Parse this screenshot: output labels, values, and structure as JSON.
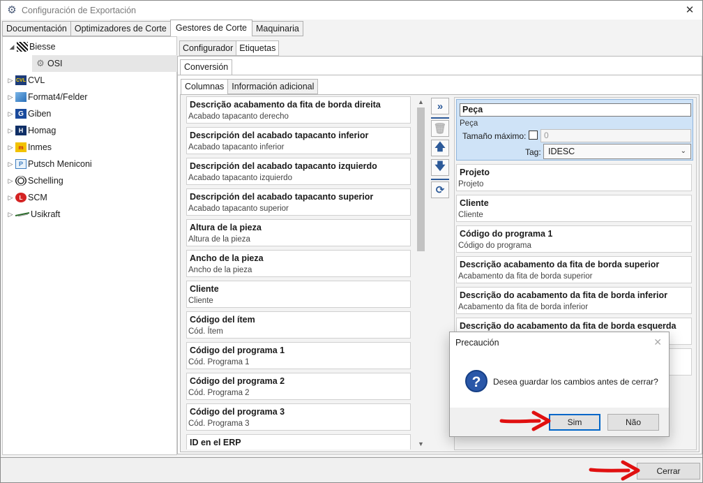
{
  "window": {
    "title": "Configuración de Exportación"
  },
  "top_tabs": [
    {
      "label": "Documentación",
      "active": false
    },
    {
      "label": "Optimizadores de Corte",
      "active": false
    },
    {
      "label": "Gestores de Corte",
      "active": true
    },
    {
      "label": "Maquinaria",
      "active": false
    }
  ],
  "tree": [
    {
      "label": "Biesse",
      "expanded": true
    },
    {
      "label": "OSI",
      "child": true,
      "selected": true
    },
    {
      "label": "CVL"
    },
    {
      "label": "Format4/Felder"
    },
    {
      "label": "Giben"
    },
    {
      "label": "Homag"
    },
    {
      "label": "Inmes"
    },
    {
      "label": "Putsch Meniconi"
    },
    {
      "label": "Schelling"
    },
    {
      "label": "SCM"
    },
    {
      "label": "Usikraft"
    }
  ],
  "sub_tabs": [
    {
      "label": "Configurador",
      "active": false
    },
    {
      "label": "Etiquetas",
      "active": true
    }
  ],
  "conversion_tab": "Conversión",
  "inner_tabs": [
    {
      "label": "Columnas",
      "active": true
    },
    {
      "label": "Información adicional",
      "active": false
    }
  ],
  "available_fields": [
    {
      "name": "Descrição acabamento da fita de borda direita",
      "sub": "Acabado tapacanto derecho"
    },
    {
      "name": "Descripción del acabado tapacanto inferior",
      "sub": "Acabado tapacanto inferior"
    },
    {
      "name": "Descripción del acabado tapacanto izquierdo",
      "sub": "Acabado tapacanto izquierdo"
    },
    {
      "name": "Descripción del acabado tapacanto superior",
      "sub": "Acabado tapacanto superior"
    },
    {
      "name": "Altura de la pieza",
      "sub": "Altura de la pieza"
    },
    {
      "name": "Ancho de la pieza",
      "sub": "Ancho de la pieza"
    },
    {
      "name": "Cliente",
      "sub": "Cliente"
    },
    {
      "name": "Código del ítem",
      "sub": "Cód. Ítem"
    },
    {
      "name": "Código del programa 1",
      "sub": "Cód. Programa 1"
    },
    {
      "name": "Código del programa 2",
      "sub": "Cód. Programa 2"
    },
    {
      "name": "Código del programa 3",
      "sub": "Cód. Programa 3"
    },
    {
      "name": "ID en el ERP",
      "sub": ""
    }
  ],
  "selected_field": {
    "name": "Peça",
    "sub": "Peça",
    "max_size_label": "Tamaño máximo:",
    "max_size_value": "0",
    "tag_label": "Tag:",
    "tag_value": "IDESC"
  },
  "selected_fields": [
    {
      "name": "Projeto",
      "sub": "Projeto"
    },
    {
      "name": "Cliente",
      "sub": "Cliente"
    },
    {
      "name": "Código do programa 1",
      "sub": "Código do programa"
    },
    {
      "name": "Descrição acabamento da fita de borda superior",
      "sub": "Acabamento da fita de borda superior"
    },
    {
      "name": "Descrição do acabamento da fita de borda inferior",
      "sub": "Acabamento da fita de borda inferior"
    },
    {
      "name": "Descrição do acabamento da fita de borda esquerda",
      "sub": ""
    }
  ],
  "dialog": {
    "title": "Precaución",
    "message": "Desea guardar los cambios antes de cerrar?",
    "yes_label": "Sim",
    "no_label": "Não"
  },
  "footer": {
    "close_label": "Cerrar"
  },
  "colors": {
    "accent": "#2c5a99",
    "selection": "#cfe3f7",
    "arrow": "#e01010"
  }
}
